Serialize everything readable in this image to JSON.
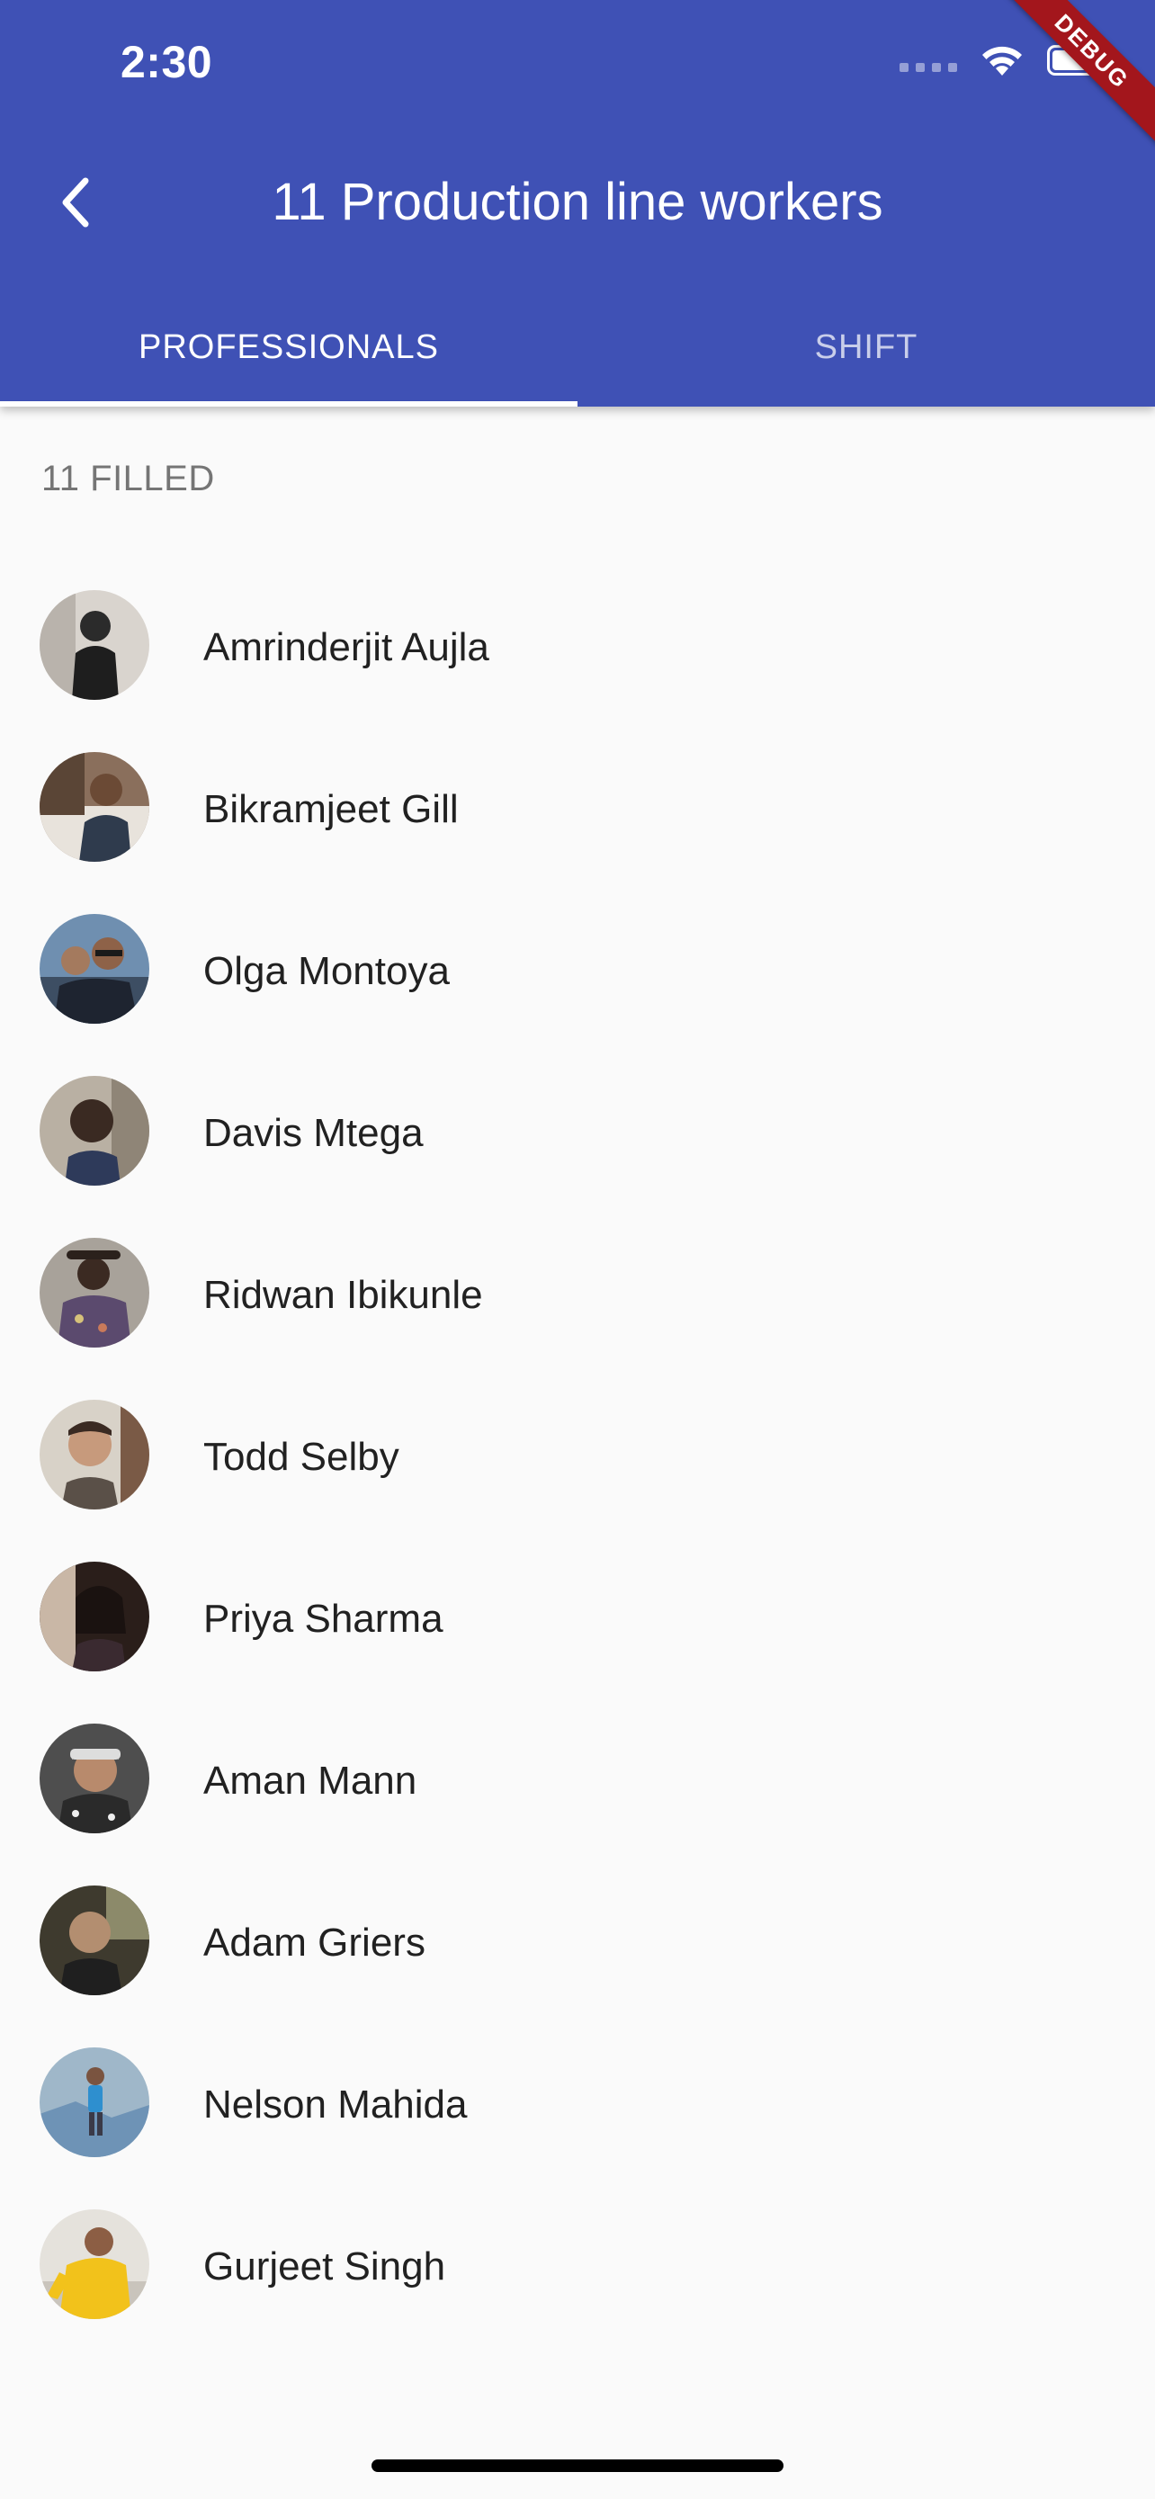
{
  "status_bar": {
    "time": "2:30",
    "icons": [
      "cellular-signal-icon",
      "wifi-icon",
      "battery-icon"
    ]
  },
  "debug_banner": "DEBUG",
  "app_bar": {
    "title": "11 Production line workers",
    "back_icon": "chevron-left-icon",
    "background_color": "#3F51B5"
  },
  "tabs": [
    {
      "label": "PROFESSIONALS",
      "selected": true
    },
    {
      "label": "SHIFT",
      "selected": false
    }
  ],
  "section_header": "11 FILLED",
  "workers": [
    {
      "name": "Amrinderjit Aujla",
      "avatar": "photo-avatar"
    },
    {
      "name": "Bikramjeet Gill",
      "avatar": "photo-avatar"
    },
    {
      "name": "Olga Montoya",
      "avatar": "photo-avatar"
    },
    {
      "name": "Davis Mtega",
      "avatar": "photo-avatar"
    },
    {
      "name": "Ridwan Ibikunle",
      "avatar": "photo-avatar"
    },
    {
      "name": "Todd Selby",
      "avatar": "photo-avatar"
    },
    {
      "name": "Priya Sharma",
      "avatar": "photo-avatar"
    },
    {
      "name": "Aman Mann",
      "avatar": "photo-avatar"
    },
    {
      "name": "Adam Griers",
      "avatar": "photo-avatar"
    },
    {
      "name": "Nelson Mahida",
      "avatar": "photo-avatar"
    },
    {
      "name": "Gurjeet Singh",
      "avatar": "photo-avatar"
    }
  ]
}
